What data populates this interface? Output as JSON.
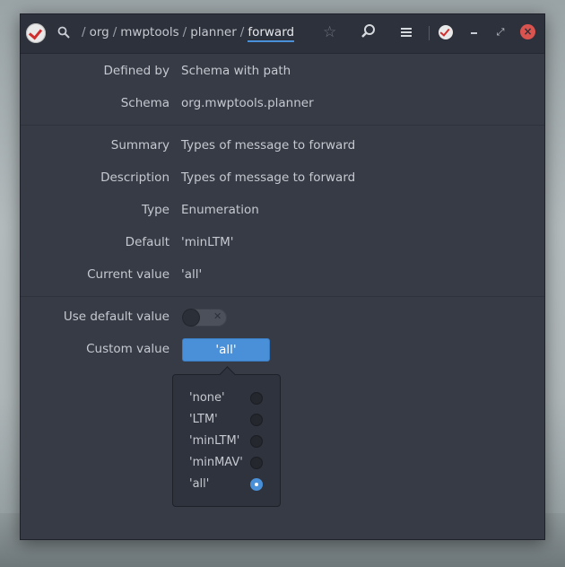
{
  "titlebar": {
    "path": [
      "org",
      "mwptools",
      "planner"
    ],
    "current": "forward",
    "separator": "/"
  },
  "icons": {
    "app": "dconf-editor-icon",
    "search": "search-icon",
    "bookmark": "star-icon",
    "find": "find-icon",
    "menu": "hamburger-menu-icon",
    "minimize": "minimize-icon",
    "maximize": "maximize-icon",
    "close": "close-icon"
  },
  "details": {
    "defined_by_label": "Defined by",
    "defined_by_value": "Schema with path",
    "schema_label": "Schema",
    "schema_value": "org.mwptools.planner",
    "summary_label": "Summary",
    "summary_value": "Types of message to forward",
    "description_label": "Description",
    "description_value": "Types of message to forward",
    "type_label": "Type",
    "type_value": "Enumeration",
    "default_label": "Default",
    "default_value": "'minLTM'",
    "current_label": "Current value",
    "current_value": "'all'"
  },
  "edit": {
    "use_default_label": "Use default value",
    "use_default_on": false,
    "custom_label": "Custom value",
    "custom_value": "'all'"
  },
  "popover": {
    "options": [
      "'none'",
      "'LTM'",
      "'minLTM'",
      "'minMAV'",
      "'all'"
    ],
    "selected": "'all'"
  },
  "colors": {
    "accent": "#4a90d9",
    "window_bg": "#363b46",
    "close": "#d9534f"
  }
}
